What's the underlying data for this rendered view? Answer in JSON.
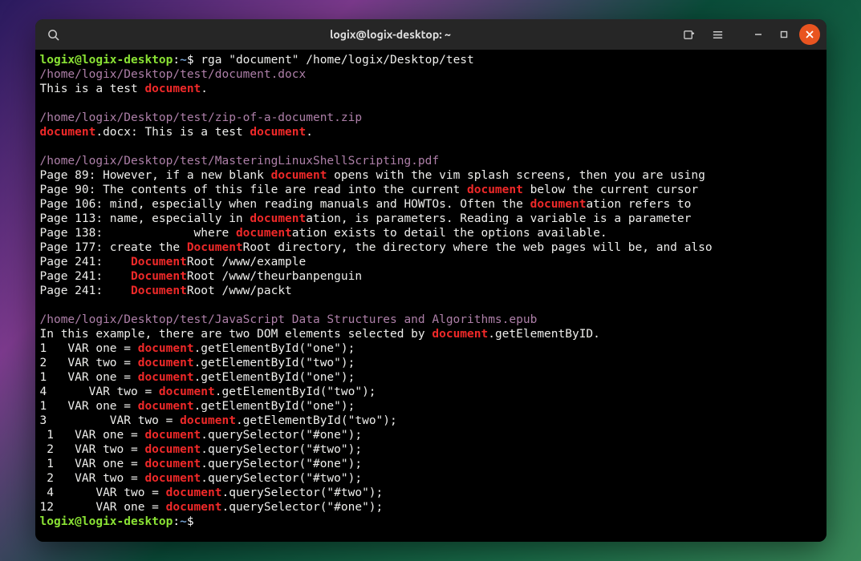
{
  "titlebar": {
    "title": "logix@logix-desktop: ~"
  },
  "prompt": {
    "user_host": "logix@logix-desktop",
    "sep1": ":",
    "path": "~",
    "dollar": "$"
  },
  "command": " rga \"document\" /home/logix/Desktop/test",
  "results": [
    {
      "path": "/home/logix/Desktop/test/document.docx",
      "lines": [
        {
          "segments": [
            {
              "t": "This is a test "
            },
            {
              "t": "document",
              "m": true
            },
            {
              "t": "."
            }
          ]
        }
      ]
    },
    {
      "path": "/home/logix/Desktop/test/zip-of-a-document.zip",
      "lines": [
        {
          "segments": [
            {
              "t": "document",
              "m": true
            },
            {
              "t": ".docx: This is a test "
            },
            {
              "t": "document",
              "m": true
            },
            {
              "t": "."
            }
          ]
        }
      ]
    },
    {
      "path": "/home/logix/Desktop/test/MasteringLinuxShellScripting.pdf",
      "lines": [
        {
          "segments": [
            {
              "t": "Page 89: However, if a new blank "
            },
            {
              "t": "document",
              "m": true
            },
            {
              "t": " opens with the vim splash screens, then you are using"
            }
          ]
        },
        {
          "segments": [
            {
              "t": "Page 90: The contents of this file are read into the current "
            },
            {
              "t": "document",
              "m": true
            },
            {
              "t": " below the current cursor"
            }
          ]
        },
        {
          "segments": [
            {
              "t": "Page 106: mind, especially when reading manuals and HOWTOs. Often the "
            },
            {
              "t": "document",
              "m": true
            },
            {
              "t": "ation refers to"
            }
          ]
        },
        {
          "segments": [
            {
              "t": "Page 113: name, especially in "
            },
            {
              "t": "document",
              "m": true
            },
            {
              "t": "ation, is parameters. Reading a variable is a parameter"
            }
          ]
        },
        {
          "segments": [
            {
              "t": "Page 138:             where "
            },
            {
              "t": "document",
              "m": true
            },
            {
              "t": "ation exists to detail the options available."
            }
          ]
        },
        {
          "segments": [
            {
              "t": "Page 177: create the "
            },
            {
              "t": "Document",
              "m": true
            },
            {
              "t": "Root directory, the directory where the web pages will be, and also"
            }
          ]
        },
        {
          "segments": [
            {
              "t": "Page 241:    "
            },
            {
              "t": "Document",
              "m": true
            },
            {
              "t": "Root /www/example"
            }
          ]
        },
        {
          "segments": [
            {
              "t": "Page 241:    "
            },
            {
              "t": "Document",
              "m": true
            },
            {
              "t": "Root /www/theurbanpenguin"
            }
          ]
        },
        {
          "segments": [
            {
              "t": "Page 241:    "
            },
            {
              "t": "Document",
              "m": true
            },
            {
              "t": "Root /www/packt"
            }
          ]
        }
      ]
    },
    {
      "path": "/home/logix/Desktop/test/JavaScript Data Structures and Algorithms.epub",
      "lines": [
        {
          "segments": [
            {
              "t": "In this example, there are two DOM elements selected by "
            },
            {
              "t": "document",
              "m": true
            },
            {
              "t": ".getElementByID."
            }
          ]
        },
        {
          "segments": [
            {
              "t": "1   VAR one = "
            },
            {
              "t": "document",
              "m": true
            },
            {
              "t": ".getElementById(\"one\");"
            }
          ]
        },
        {
          "segments": [
            {
              "t": "2   VAR two = "
            },
            {
              "t": "document",
              "m": true
            },
            {
              "t": ".getElementById(\"two\");"
            }
          ]
        },
        {
          "segments": [
            {
              "t": "1   VAR one = "
            },
            {
              "t": "document",
              "m": true
            },
            {
              "t": ".getElementById(\"one\");"
            }
          ]
        },
        {
          "segments": [
            {
              "t": "4      VAR two = "
            },
            {
              "t": "document",
              "m": true
            },
            {
              "t": ".getElementById(\"two\");"
            }
          ]
        },
        {
          "segments": [
            {
              "t": "1   VAR one = "
            },
            {
              "t": "document",
              "m": true
            },
            {
              "t": ".getElementById(\"one\");"
            }
          ]
        },
        {
          "segments": [
            {
              "t": "3         VAR two = "
            },
            {
              "t": "document",
              "m": true
            },
            {
              "t": ".getElementById(\"two\");"
            }
          ]
        },
        {
          "segments": [
            {
              "t": " 1   VAR one = "
            },
            {
              "t": "document",
              "m": true
            },
            {
              "t": ".querySelector(\"#one\");"
            }
          ]
        },
        {
          "segments": [
            {
              "t": " 2   VAR two = "
            },
            {
              "t": "document",
              "m": true
            },
            {
              "t": ".querySelector(\"#two\");"
            }
          ]
        },
        {
          "segments": [
            {
              "t": " 1   VAR one = "
            },
            {
              "t": "document",
              "m": true
            },
            {
              "t": ".querySelector(\"#one\");"
            }
          ]
        },
        {
          "segments": [
            {
              "t": " 2   VAR two = "
            },
            {
              "t": "document",
              "m": true
            },
            {
              "t": ".querySelector(\"#two\");"
            }
          ]
        },
        {
          "segments": [
            {
              "t": " 4      VAR two = "
            },
            {
              "t": "document",
              "m": true
            },
            {
              "t": ".querySelector(\"#two\");"
            }
          ]
        },
        {
          "segments": [
            {
              "t": "12      VAR one = "
            },
            {
              "t": "document",
              "m": true
            },
            {
              "t": ".querySelector(\"#one\");"
            }
          ]
        }
      ]
    }
  ]
}
